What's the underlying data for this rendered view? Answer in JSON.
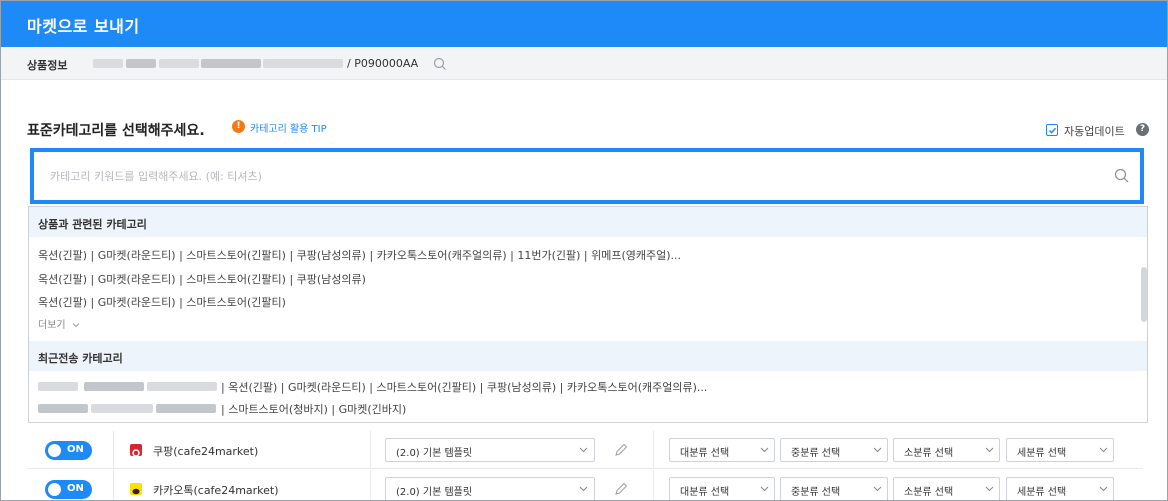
{
  "window": {
    "title": "마켓으로 보내기"
  },
  "product": {
    "label": "상품정보",
    "code": "/ P090000AA",
    "search_icon": "search-icon"
  },
  "category": {
    "title": "표준카테고리를 선택해주세요.",
    "tip": "카테고리 활용 TIP",
    "auto_update": {
      "label": "자동업데이트",
      "checked": true
    }
  },
  "search": {
    "placeholder": "카테고리 키워드를 입력해주세요. (예: 티셔츠)",
    "value": ""
  },
  "related": {
    "title": "상품과 관련된 카테고리",
    "items": [
      "옥션(긴팔) | G마켓(라운드티) | 스마트스토어(긴팔티) | 쿠팡(남성의류) | 카카오톡스토어(캐주얼의류) | 11번가(긴팔) | 위메프(영캐주얼)...",
      "옥션(긴팔) | G마켓(라운드티) | 스마트스토어(긴팔티) | 쿠팡(남성의류)",
      "옥션(긴팔) | G마켓(라운드티) | 스마트스토어(긴팔티)"
    ],
    "more": "더보기"
  },
  "recent": {
    "title": "최근전송 카테고리",
    "items": [
      "| 옥션(긴팔) | G마켓(라운드티) | 스마트스토어(긴팔티) | 쿠팡(남성의류) | 카카오톡스토어(캐주얼의류)...",
      "| 스마트스토어(청바지) | G마켓(긴바지)"
    ]
  },
  "markets": [
    {
      "toggle": "ON",
      "name": "쿠팡(cafe24market)",
      "logo_color": "#d7262e",
      "template": "(2.0) 기본 템플릿",
      "selects": [
        "대분류 선택",
        "중분류 선택",
        "소분류 선택",
        "세분류 선택"
      ]
    },
    {
      "toggle": "ON",
      "name": "카카오톡(cafe24market)",
      "logo_color": "#fae100",
      "template": "(2.0) 기본 템플릿",
      "selects": [
        "대분류 선택",
        "중분류 선택",
        "소분류 선택",
        "세분류 선택"
      ]
    }
  ],
  "colors": {
    "accent": "#1e8af7",
    "tip": "#f07b16"
  }
}
